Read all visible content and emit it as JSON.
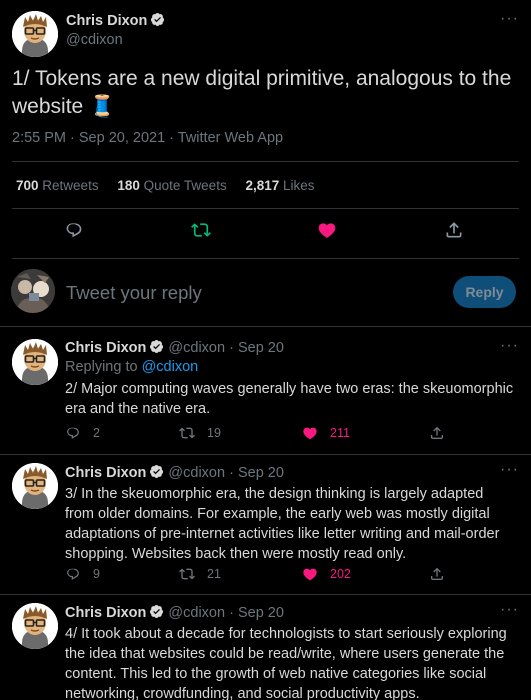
{
  "main_tweet": {
    "author_name": "Chris Dixon",
    "author_handle": "@cdixon",
    "text": "1/ Tokens are a new digital primitive, analogous to the website 🧵",
    "meta": "2:55 PM · Sep 20, 2021 · Twitter Web App",
    "stats": {
      "retweets_count": "700",
      "retweets_label": "Retweets",
      "quotes_count": "180",
      "quotes_label": "Quote Tweets",
      "likes_count": "2,817",
      "likes_label": "Likes"
    },
    "more_label": "···"
  },
  "reply_box": {
    "placeholder": "Tweet your reply",
    "button_label": "Reply"
  },
  "replies": [
    {
      "author_name": "Chris Dixon",
      "author_handle": "@cdixon",
      "date": "Sep 20",
      "replying_prefix": "Replying to",
      "replying_handle": "@cdixon",
      "text": "2/ Major computing waves generally have two eras: the skeuomorphic era and the native era.",
      "replies_count": "2",
      "retweets_count": "19",
      "likes_count": "211",
      "more_label": "···"
    },
    {
      "author_name": "Chris Dixon",
      "author_handle": "@cdixon",
      "date": "Sep 20",
      "text": "3/ In the skeuomorphic era, the design thinking is largely adapted from older domains. For example, the early web was mostly digital adaptations of pre-internet activities like letter writing and mail-order shopping. Websites back then were mostly read only.",
      "replies_count": "9",
      "retweets_count": "21",
      "likes_count": "202",
      "more_label": "···"
    },
    {
      "author_name": "Chris Dixon",
      "author_handle": "@cdixon",
      "date": "Sep 20",
      "text": "4/ It took about a decade for technologists to start seriously exploring the idea that websites could be read/write, where users generate the content. This led to the growth of web native categories like social networking, crowdfunding, and social productivity apps.",
      "more_label": "···"
    }
  ],
  "separator": "·",
  "colors": {
    "background": "#000000",
    "text": "#d9d9d9",
    "muted": "#6e767d",
    "accent_blue": "#1d9bf0",
    "like_pink": "#f91880",
    "retweet_green": "#00ba7c",
    "divider": "#2f3336"
  }
}
